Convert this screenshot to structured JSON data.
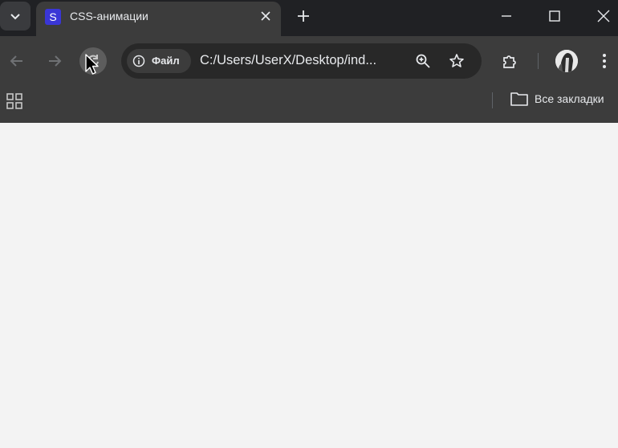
{
  "tab": {
    "favicon_letter": "S",
    "title": "CSS-анимации"
  },
  "omnibox": {
    "security_label": "Файл",
    "url": "C:/Users/UserX/Desktop/ind..."
  },
  "bookmarks": {
    "all_label": "Все закладки"
  },
  "colors": {
    "titlebar": "#202124",
    "toolbar": "#3c3c3c",
    "omnibox": "#282828",
    "favicon": "#3a36d6",
    "page": "#f3f3f3"
  }
}
